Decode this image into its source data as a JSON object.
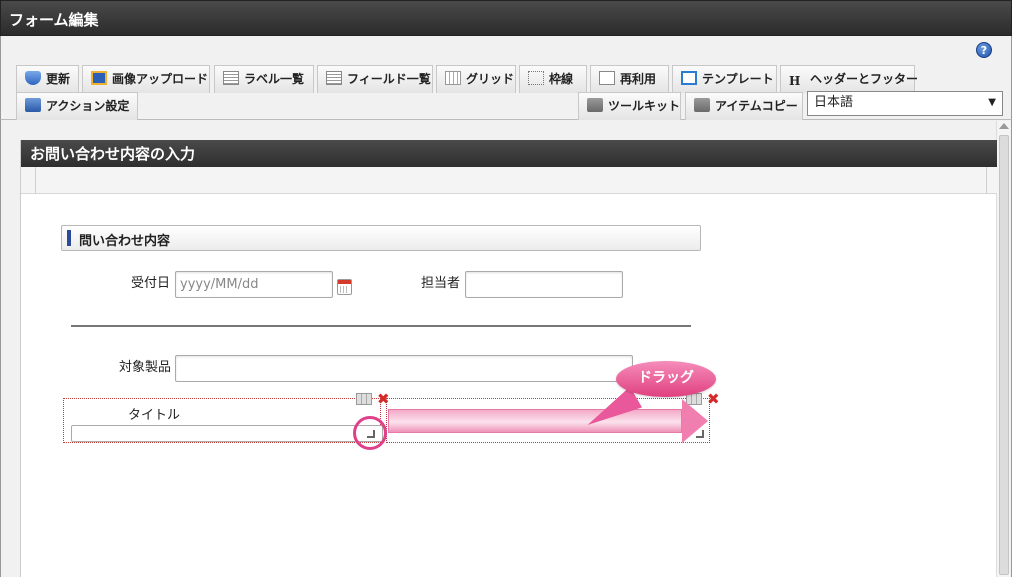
{
  "app": {
    "title": "フォーム編集"
  },
  "help": {
    "icon_label": "?"
  },
  "toolbar": {
    "tabs": [
      {
        "label": "更新",
        "icon": "refresh-icon"
      },
      {
        "label": "画像アップロード",
        "icon": "image-upload-icon"
      },
      {
        "label": "ラベル一覧",
        "icon": "label-list-icon"
      },
      {
        "label": "フィールド一覧",
        "icon": "field-list-icon"
      },
      {
        "label": "グリッド",
        "icon": "grid-icon"
      },
      {
        "label": "枠線",
        "icon": "border-icon"
      },
      {
        "label": "再利用",
        "icon": "reuse-icon"
      },
      {
        "label": "テンプレート",
        "icon": "template-icon"
      },
      {
        "label": "ヘッダーとフッター",
        "icon": "header-footer-icon"
      }
    ],
    "action_tab": {
      "label": "アクション設定",
      "icon": "action-icon"
    },
    "toolkit_tab": {
      "label": "ツールキット",
      "icon": "toolbox-icon"
    },
    "itemcopy_tab": {
      "label": "アイテムコピー",
      "icon": "toolbox-icon"
    },
    "language": {
      "selected": "日本語"
    }
  },
  "page": {
    "header": "お問い合わせ内容の入力",
    "section_title": "問い合わせ内容",
    "fields": {
      "received_date": {
        "label": "受付日",
        "placeholder": "yyyy/MM/dd"
      },
      "assignee": {
        "label": "担当者",
        "value": ""
      },
      "product": {
        "label": "対象製品",
        "value": ""
      },
      "title": {
        "label": "タイトル",
        "value": ""
      }
    }
  },
  "annotation": {
    "callout": "ドラッグ"
  },
  "colors": {
    "accent": "#e0408a",
    "header_dark": "#333333",
    "section_bar": "#2b4a9a"
  }
}
